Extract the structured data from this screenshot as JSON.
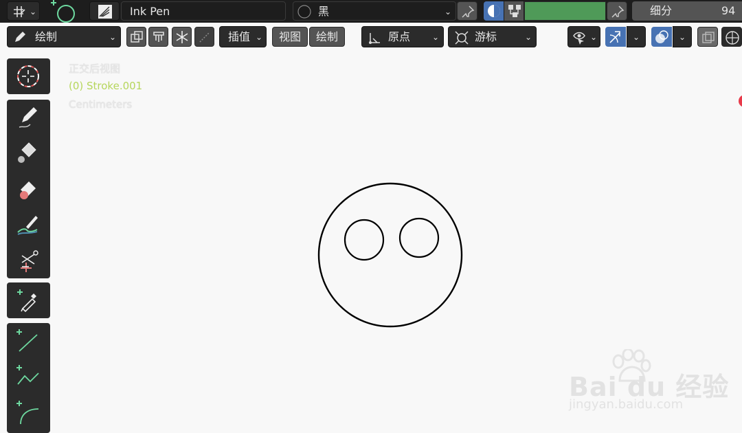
{
  "header": {
    "brush_name": "Ink Pen",
    "material_name": "黑",
    "subdivision_label": "细分",
    "subdivision_value": "94",
    "color_swatch": "#4f9a58"
  },
  "tool_header": {
    "mode_label": "绘制",
    "interpolate_label": "插值",
    "view_label": "视图",
    "draw_label": "绘制",
    "origin_label": "原点",
    "cursor_label": "游标"
  },
  "viewport": {
    "view_name": "正交后视图",
    "object_info": "(0) Stroke.001",
    "units": "Centimeters"
  },
  "toolbar": {
    "items": [
      "cursor-tool",
      "draw-tool",
      "fill-tool",
      "erase-tool",
      "tint-tool",
      "cutter-tool",
      "eyedropper-tool",
      "line-tool",
      "polyline-tool",
      "arc-tool"
    ]
  },
  "watermark": {
    "brand": "Bai  du 经验",
    "url": "jingyan.baidu.com"
  },
  "colors": {
    "accent_blue": "#4772b3",
    "green_plus": "#6ed9a0",
    "selected_object": "#b6d65c",
    "record_red": "#e83a4a"
  }
}
